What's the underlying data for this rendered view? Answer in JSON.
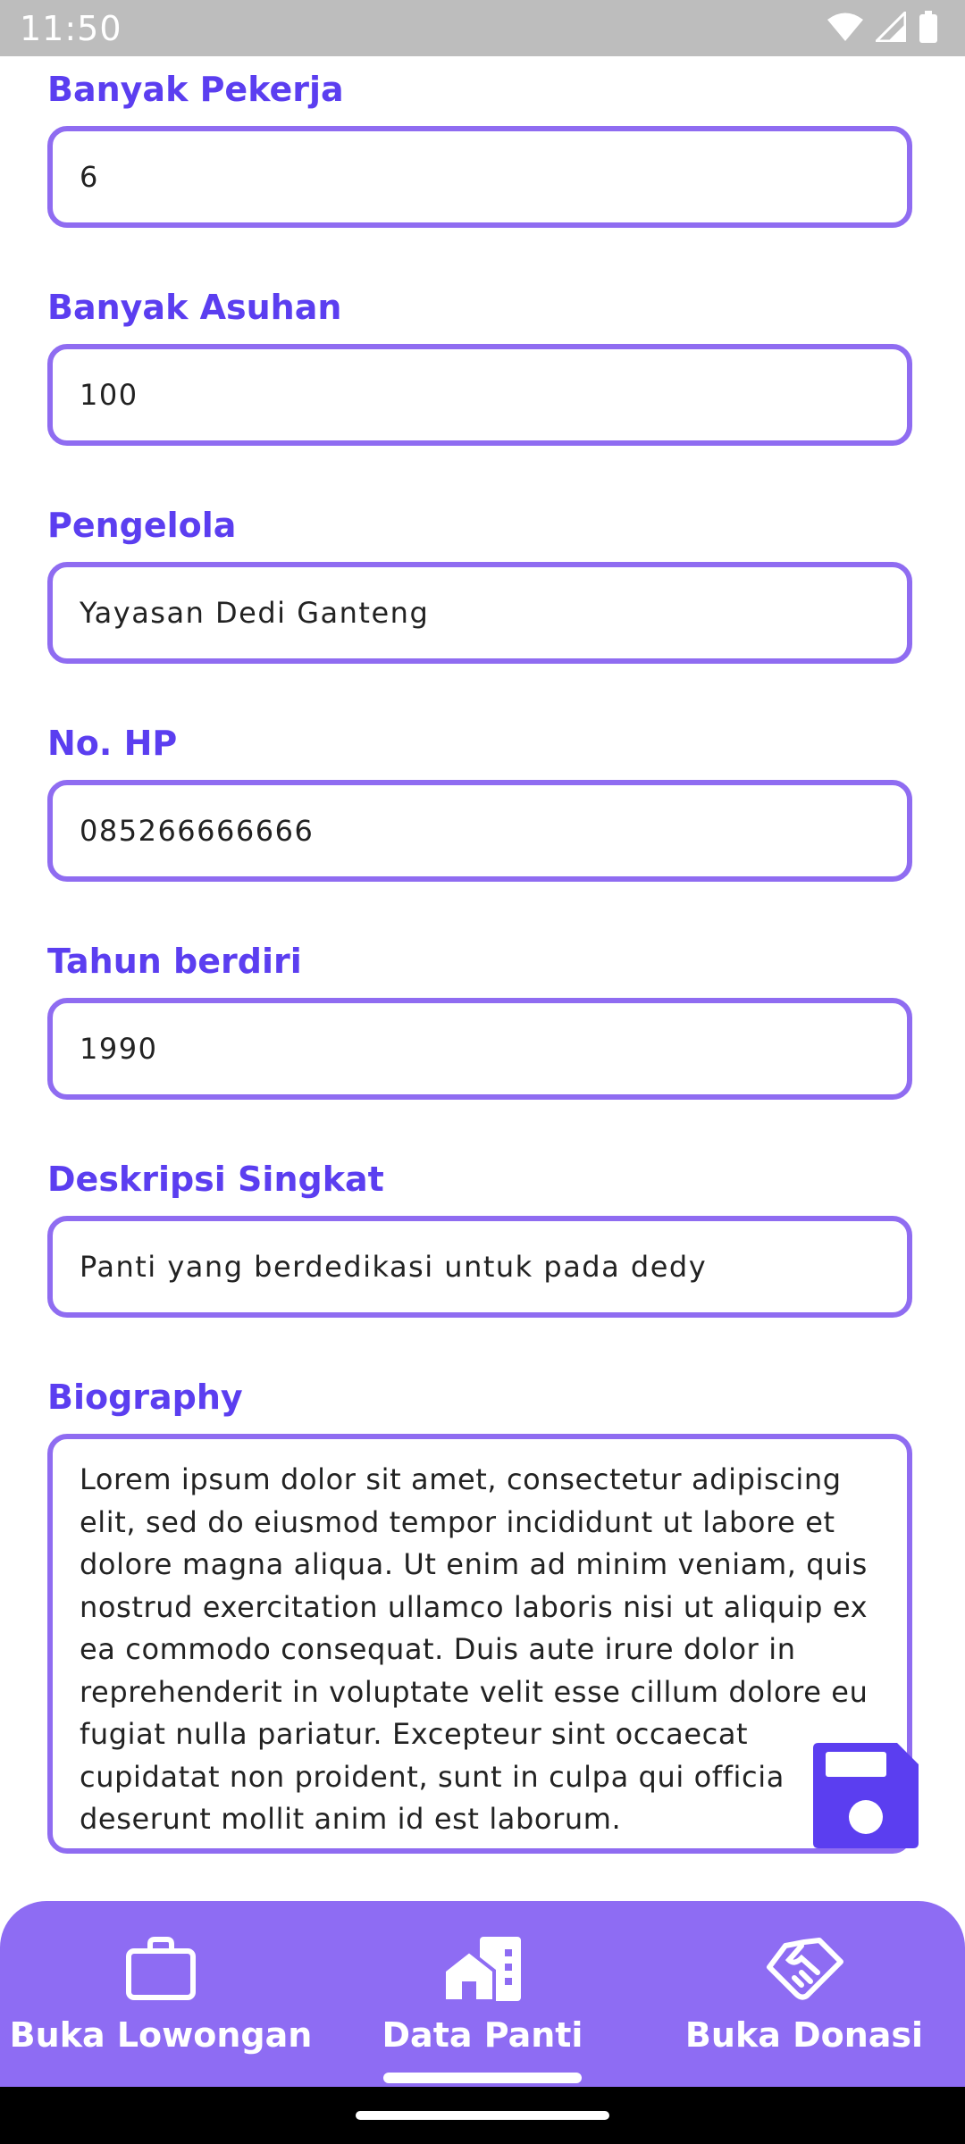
{
  "status_bar": {
    "time": "11:50",
    "icons": [
      "wifi-icon",
      "signal-icon",
      "battery-icon"
    ]
  },
  "form": {
    "fields": [
      {
        "label": "Banyak Pekerja",
        "value": "6"
      },
      {
        "label": "Banyak Asuhan",
        "value": "100"
      },
      {
        "label": "Pengelola",
        "value": "Yayasan Dedi Ganteng"
      },
      {
        "label": "No. HP",
        "value": "085266666666"
      },
      {
        "label": "Tahun berdiri",
        "value": "1990"
      },
      {
        "label": "Deskripsi Singkat",
        "value": "Panti yang berdedikasi untuk pada dedy"
      }
    ],
    "biography": {
      "label": "Biography",
      "value": "Lorem ipsum dolor sit amet, consectetur adipiscing elit, sed do eiusmod tempor incididunt ut labore et dolore magna aliqua. Ut enim ad minim veniam, quis nostrud exercitation ullamco laboris nisi ut aliquip ex ea commodo consequat. Duis aute irure dolor in reprehenderit in voluptate velit esse cillum dolore eu fugiat nulla pariatur. Excepteur sint occaecat cupidatat non proident, sunt in culpa qui officia deserunt mollit anim id est laborum."
    }
  },
  "fab": {
    "icon": "save-icon"
  },
  "bottom_nav": {
    "items": [
      {
        "label": "Buka Lowongan",
        "icon": "briefcase-icon"
      },
      {
        "label": "Data Panti",
        "icon": "house-building-icon",
        "selected": true
      },
      {
        "label": "Buka Donasi",
        "icon": "handshake-icon"
      }
    ]
  },
  "colors": {
    "accent": "#5b3ef0",
    "border": "#8f6cf1",
    "nav_bg": "#8e6cf3",
    "status_bar_bg": "#bdbdbd"
  }
}
